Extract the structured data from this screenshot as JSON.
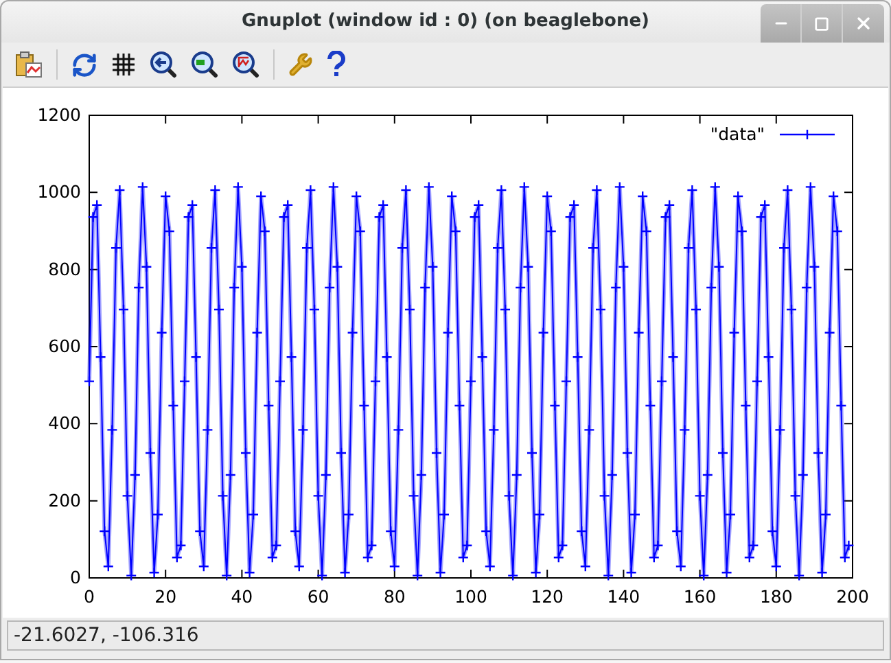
{
  "window": {
    "title": "Gnuplot (window id : 0) (on beaglebone)"
  },
  "plot": {
    "chart_data": {
      "type": "line",
      "xlim": [
        0,
        200
      ],
      "ylim": [
        0,
        1200
      ],
      "xticks": [
        0,
        20,
        40,
        60,
        80,
        100,
        120,
        140,
        160,
        180,
        200
      ],
      "yticks": [
        0,
        200,
        400,
        600,
        800,
        1000,
        1200
      ],
      "x": [
        0,
        1,
        2,
        3,
        4,
        5,
        6,
        7,
        8,
        9,
        10,
        11,
        12,
        13,
        14,
        15,
        16,
        17,
        18,
        19,
        20,
        21,
        22,
        23,
        24,
        25,
        26,
        27,
        28,
        29,
        30,
        31,
        32,
        33,
        34,
        35,
        36,
        37,
        38,
        39,
        40,
        41,
        42,
        43,
        44,
        45,
        46,
        47,
        48,
        49,
        50,
        51,
        52,
        53,
        54,
        55,
        56,
        57,
        58,
        59,
        60,
        61,
        62,
        63,
        64,
        65,
        66,
        67,
        68,
        69,
        70,
        71,
        72,
        73,
        74,
        75,
        76,
        77,
        78,
        79,
        80,
        81,
        82,
        83,
        84,
        85,
        86,
        87,
        88,
        89,
        90,
        91,
        92,
        93,
        94,
        95,
        96,
        97,
        98,
        99,
        100,
        101,
        102,
        103,
        104,
        105,
        106,
        107,
        108,
        109,
        110,
        111,
        112,
        113,
        114,
        115,
        116,
        117,
        118,
        119,
        120,
        121,
        122,
        123,
        124,
        125,
        126,
        127,
        128,
        129,
        130,
        131,
        132,
        133,
        134,
        135,
        136,
        137,
        138,
        139,
        140,
        141,
        142,
        143,
        144,
        145,
        146,
        147,
        148,
        149,
        150,
        151,
        152,
        153,
        154,
        155,
        156,
        157,
        158,
        159,
        160,
        161,
        162,
        163,
        164,
        165,
        166,
        167,
        168,
        169,
        170,
        171,
        172,
        173,
        174,
        175,
        176,
        177,
        178,
        179,
        180,
        181,
        182,
        183,
        184,
        185,
        186,
        187,
        188,
        189,
        190,
        191,
        192,
        193,
        194,
        195,
        196,
        197,
        198,
        199
      ],
      "series": [
        {
          "name": "\"data\"",
          "color": "#0000ff",
          "marker": "+",
          "values": [
            510,
            936,
            967,
            573,
            121,
            30,
            384,
            856,
            1006,
            696,
            213,
            6,
            267,
            753,
            1014,
            807,
            324,
            14,
            164,
            636,
            990,
            899,
            447,
            53,
            84,
            510,
            936,
            967,
            573,
            121,
            30,
            384,
            856,
            1006,
            696,
            213,
            6,
            267,
            753,
            1014,
            807,
            324,
            14,
            164,
            636,
            990,
            899,
            447,
            53,
            84,
            510,
            936,
            967,
            573,
            121,
            30,
            384,
            856,
            1006,
            696,
            213,
            6,
            267,
            753,
            1014,
            807,
            324,
            14,
            164,
            636,
            990,
            899,
            447,
            53,
            84,
            510,
            936,
            967,
            573,
            121,
            30,
            384,
            856,
            1006,
            696,
            213,
            6,
            267,
            753,
            1014,
            807,
            324,
            14,
            164,
            636,
            990,
            899,
            447,
            53,
            84,
            510,
            936,
            967,
            573,
            121,
            30,
            384,
            856,
            1006,
            696,
            213,
            6,
            267,
            753,
            1014,
            807,
            324,
            14,
            164,
            636,
            990,
            899,
            447,
            53,
            84,
            510,
            936,
            967,
            573,
            121,
            30,
            384,
            856,
            1006,
            696,
            213,
            6,
            267,
            753,
            1014,
            807,
            324,
            14,
            164,
            636,
            990,
            899,
            447,
            53,
            84,
            510,
            936,
            967,
            573,
            121,
            30,
            384,
            856,
            1006,
            696,
            213,
            6,
            267,
            753,
            1014,
            807,
            324,
            14,
            164,
            636,
            990,
            899,
            447,
            53,
            84,
            510,
            936,
            967,
            573,
            121,
            30,
            384,
            856,
            1006,
            696,
            213,
            6,
            267,
            753,
            1014,
            807,
            324,
            14,
            164,
            636,
            990,
            899,
            447,
            53,
            84
          ]
        }
      ]
    }
  },
  "status_bar": {
    "text": "-21.6027, -106.316"
  }
}
